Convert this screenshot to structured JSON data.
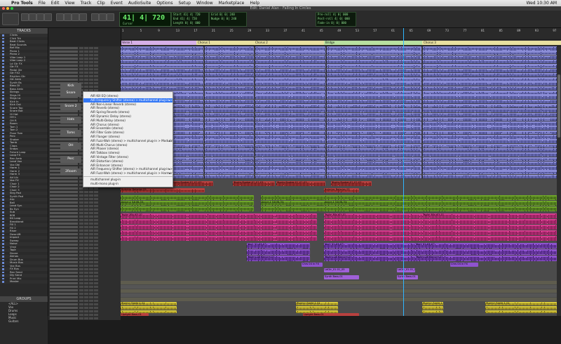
{
  "menubar": {
    "app_name": "Pro Tools",
    "items": [
      "File",
      "Edit",
      "View",
      "Track",
      "Clip",
      "Event",
      "AudioSuite",
      "Options",
      "Setup",
      "Window",
      "Marketplace",
      "Help"
    ],
    "clock": "Wed 10:30 AM"
  },
  "window": {
    "title": "Edit: Daniel Alan - Falling In Circles"
  },
  "counter": {
    "main": "41| 4| 720",
    "main_label": "Cursor",
    "start_label": "Start",
    "end_label": "End",
    "length_label": "Length",
    "start_value": "41| 4| 720",
    "end_value": "41| 4| 720",
    "length_value": "0| 0| 000",
    "pre_label": "Pre-roll",
    "post_label": "Post-roll",
    "fade_label": "Fade-in",
    "pre_value": "4| 0| 000",
    "post_value": "4| 0| 000",
    "fade_value": "0| 0| 000",
    "nudge_label": "Nudge",
    "nudge_value": "0| 0| 240",
    "grid_label": "Grid",
    "grid_value": "0| 0| 240"
  },
  "ruler": {
    "bars_label": "Bars|Beats",
    "markers_label": "Markers",
    "tempo_label": "Tempo",
    "bar_numbers": [
      "1",
      "5",
      "9",
      "13",
      "17",
      "21",
      "25",
      "29",
      "33",
      "37",
      "41",
      "45",
      "49",
      "53",
      "57",
      "61",
      "65",
      "69",
      "73",
      "77",
      "81",
      "85",
      "89",
      "93",
      "97"
    ],
    "markers": [
      {
        "label": "Verse 1",
        "color": "#d6b0e8"
      },
      {
        "label": "Chorus 1",
        "color": "#e8e0a0"
      },
      {
        "label": "Chorus 2",
        "color": "#e8e0a0"
      },
      {
        "label": "Bridge",
        "color": "#b8e0a0"
      },
      {
        "label": "Chorus 3",
        "color": "#e8e0a0"
      }
    ]
  },
  "left_panel": {
    "tracks_heading": "TRACKS",
    "tracks": [
      "Clicks",
      "Click Trk",
      "Beat Clicks",
      "Beat Sounds",
      "Ref Mix",
      "Piano 1",
      "Piano 2",
      "Vibe Loop 1",
      "Vibe Loop 2",
      "Ld Gtr FX",
      "Gtr FX",
      "Pedal Gtr",
      "Gtr FX2",
      "Rhythm Gtr",
      "Gtr Amb",
      "Synth Bs",
      "Bass DI",
      "Bass Amb",
      "Strings",
      "Strgs Hi",
      "Strgs Lo",
      "Kick In",
      "Kick Out",
      "Snare Top",
      "Snare Bot",
      "Hi Hat",
      "OH L",
      "OH R",
      "Room",
      "Tom 1",
      "Tom 2",
      "Floor Tom",
      "Perc",
      "Shaker",
      "Tamb",
      "Claps",
      "Snaps",
      "Future Loop",
      "Loop FX",
      "Rev Amb",
      "Lead Vox",
      "Vox Dbl",
      "Harm 1",
      "Harm 2",
      "Harm 3",
      "Ad Lib",
      "Vox FX",
      "Choir 1",
      "Choir 2",
      "Choir 3",
      "Strg Pad",
      "Synth Pad",
      "Arp",
      "Bell",
      "Lead Syn",
      "Bs Syn",
      "Sub",
      "808",
      "Kit Loop",
      "Breakbeat",
      "Fill 1",
      "Fill 2",
      "Riser",
      "Downlift",
      "Impact",
      "Sweep",
      "Noise",
      "Vinyl",
      "Tape",
      "Drone",
      "Atmos",
      "Drum Bus",
      "Music Bus",
      "Vox Bus",
      "FX Bus",
      "Rev Send",
      "Dly Send",
      "Print Mix",
      "Master"
    ],
    "groups_heading": "GROUPS",
    "groups": [
      "<ALL>",
      "Vox",
      "Drums",
      "Loops",
      "Music",
      "Guitars"
    ]
  },
  "track_labels": [
    "Kick",
    "Snare",
    "Snare 2",
    "Hats",
    "Toms",
    "OH",
    "Perc",
    "2Room"
  ],
  "plugin_menu": {
    "items": [
      {
        "label": "AIR Kill EQ (stereo)",
        "sub": false
      },
      {
        "label": "AIR Frequency Shifter (stereo) > multichannel plug-in > Pitch Shift",
        "sub": true
      },
      {
        "label": "AIR Non-Linear Reverb (stereo)",
        "sub": false
      },
      {
        "label": "AIR Reverb (stereo)",
        "sub": false
      },
      {
        "label": "AIR Spring Reverb (stereo)",
        "sub": false
      },
      {
        "label": "AIR Dynamic Delay (stereo)",
        "sub": false
      },
      {
        "label": "AIR Multi-Delay (stereo)",
        "sub": false
      },
      {
        "label": "AIR Chorus (stereo)",
        "sub": false
      },
      {
        "label": "AIR Ensemble (stereo)",
        "sub": false
      },
      {
        "label": "AIR Filter Gate (stereo)",
        "sub": false
      },
      {
        "label": "AIR Flanger (stereo)",
        "sub": false
      },
      {
        "label": "AIR Fuzz-Wah (stereo) > multichannel plug-in > Modulation",
        "sub": true
      },
      {
        "label": "AIR Multi-Chorus (stereo)",
        "sub": false
      },
      {
        "label": "AIR Phaser (stereo)",
        "sub": false
      },
      {
        "label": "AIR Talkbox (stereo)",
        "sub": false
      },
      {
        "label": "AIR Vintage Filter (stereo)",
        "sub": false
      },
      {
        "label": "AIR Distortion (stereo)",
        "sub": false
      },
      {
        "label": "AIR Enhancer (stereo)",
        "sub": false
      },
      {
        "label": "AIR Frequency Shifter (stereo) > multichannel plug-in > Harmonic",
        "sub": true
      },
      {
        "label": "AIR Fuzz-Wah (stereo) > multichannel plug-in > Harmonic",
        "sub": true
      }
    ],
    "footer": [
      "multichannel plug-in",
      "multi-mono plug-in"
    ],
    "highlighted_index": 1
  },
  "clips": {
    "shaker": "Shaka Shaker 01_01-01",
    "bolerias": "Bolerias Bolerias 05",
    "loops": "Loops 1 01-01-03",
    "taylor": "Taylor Mix_01-01",
    "vox": "Vox1 01-01_07",
    "techno": "Techno 08 Bounce-01",
    "choir": "Chrs 04 in FX",
    "ld_gtr": "LdGtr_01-01_05",
    "synth": "Synth Bass-01",
    "stormy": "Stormy Santo 1-01",
    "upright": "Upright Bass-01"
  },
  "colors": {
    "blue_clip": "#8a8cd6",
    "wave_dark": "#2e3270",
    "green_clip": "#6fa52a",
    "pink_clip": "#d63c8e",
    "purple_clip": "#8f53cf",
    "yellow_clip": "#d7c93a",
    "red_clip": "#b8413f",
    "playhead": "#2fb6ff"
  }
}
